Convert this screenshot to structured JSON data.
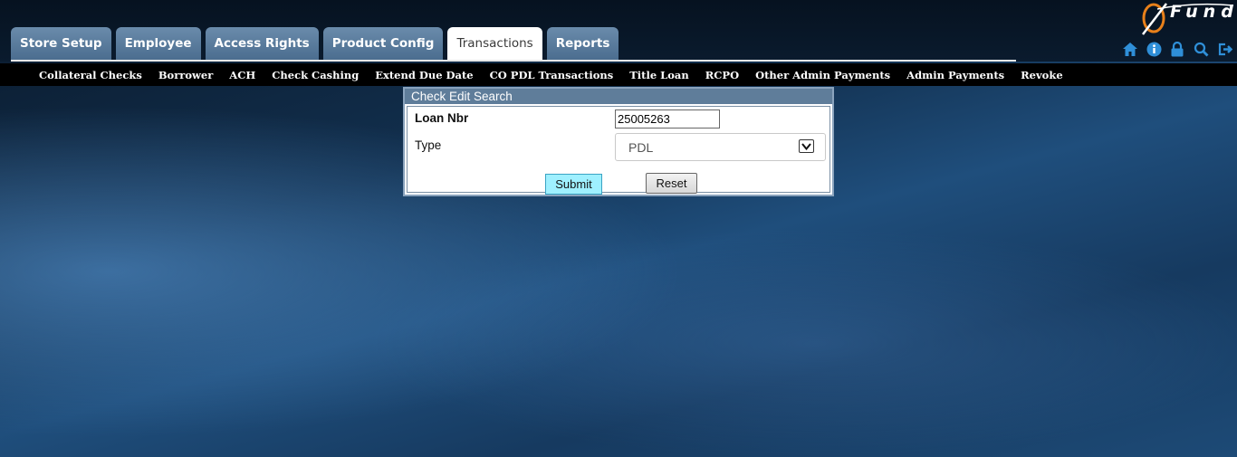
{
  "app": {
    "logo_text": "Fund"
  },
  "tabs": [
    {
      "label": "Store Setup",
      "active": false
    },
    {
      "label": "Employee",
      "active": false
    },
    {
      "label": "Access Rights",
      "active": false
    },
    {
      "label": "Product Config",
      "active": false
    },
    {
      "label": "Transactions",
      "active": true
    },
    {
      "label": "Reports",
      "active": false
    }
  ],
  "header_icons": [
    "home-icon",
    "info-icon",
    "lock-icon",
    "search-icon",
    "logout-icon"
  ],
  "subnav": [
    "Collateral Checks",
    "Borrower",
    "ACH",
    "Check Cashing",
    "Extend Due Date",
    "CO PDL Transactions",
    "Title Loan",
    "RCPO",
    "Other Admin Payments",
    "Admin Payments",
    "Revoke"
  ],
  "form": {
    "title": "Check Edit Search",
    "loan_label": "Loan Nbr",
    "loan_value": "25005263",
    "type_label": "Type",
    "type_value": "PDL",
    "submit_label": "Submit",
    "reset_label": "Reset"
  },
  "colors": {
    "accent_tab": "#5b7c9d",
    "submit_bg": "#9ff0ff",
    "icon_blue": "#2f8fd8",
    "logo_orange": "#e8801a"
  }
}
